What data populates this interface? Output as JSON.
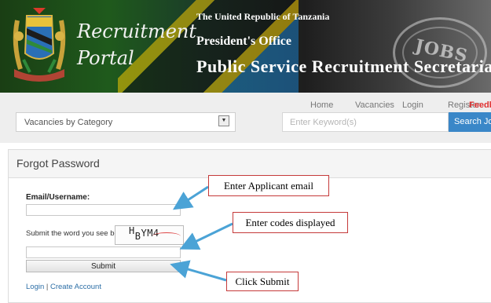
{
  "banner": {
    "logo_line1": "Recruitment",
    "logo_line2": "Portal",
    "header_line1": "The United Republic of Tanzania",
    "header_line2": "President's Office",
    "header_line3": "Public Service Recruitment Secretariat",
    "stamp_text": "JOBS"
  },
  "nav": {
    "items": [
      "Home",
      "Vacancies",
      "Login",
      "Register",
      "Feedba"
    ]
  },
  "search": {
    "category_value": "Vacancies by Category",
    "keyword_placeholder": "Enter Keyword(s)",
    "button_label": "Search Jobs"
  },
  "form": {
    "title": "Forgot Password",
    "email_label": "Email/Username:",
    "email_value": "",
    "word_label": "Submit the word you see below",
    "captcha_text": "HBYM4",
    "code_value": "",
    "submit_label": "Submit",
    "login_link": "Login",
    "separator": "|",
    "create_link": "Create Account"
  },
  "annotations": {
    "email_hint": "Enter Applicant email",
    "code_hint": "Enter codes displayed",
    "submit_hint": "Click Submit"
  },
  "colors": {
    "accent_blue": "#3a87c8",
    "feedback_red": "#e03030",
    "callout_border": "#c53a3a",
    "arrow_blue": "#4ba3d6"
  }
}
